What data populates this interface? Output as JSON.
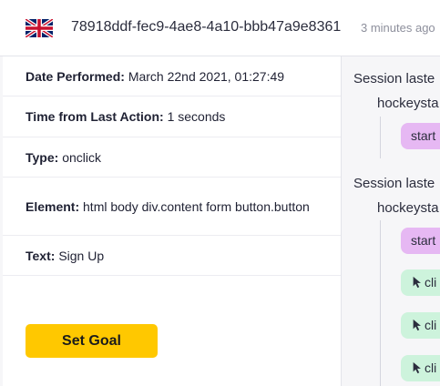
{
  "header": {
    "flag_icon": "uk-flag-icon",
    "session_id": "78918ddf-fec9-4ae8-4a10-bbb47a9e8361",
    "time_ago": "3 minutes ago"
  },
  "details": {
    "date_label": "Date Performed:",
    "date_value": "March 22nd 2021, 01:27:49",
    "time_label": "Time from Last Action:",
    "time_value": "1 seconds",
    "type_label": "Type:",
    "type_value": "onclick",
    "element_label": "Element:",
    "element_value": "html body div.content form button.button",
    "text_label": "Text:",
    "text_value": "Sign Up"
  },
  "actions": {
    "set_goal_label": "Set Goal"
  },
  "sessions": [
    {
      "title": "Session laste",
      "user": "hockeysta",
      "events": [
        {
          "label": "start",
          "kind": "start"
        }
      ]
    },
    {
      "title": "Session laste",
      "user": "hockeysta",
      "events": [
        {
          "label": "start",
          "kind": "start"
        },
        {
          "label": "cli",
          "kind": "click",
          "icon": "cursor-icon"
        },
        {
          "label": "cli",
          "kind": "click",
          "icon": "cursor-icon"
        },
        {
          "label": "cli",
          "kind": "click",
          "icon": "cursor-icon"
        }
      ]
    }
  ],
  "colors": {
    "accent_yellow": "#ffc800",
    "start_purple": "#e6b8f3",
    "click_green": "#cdf3dc"
  }
}
